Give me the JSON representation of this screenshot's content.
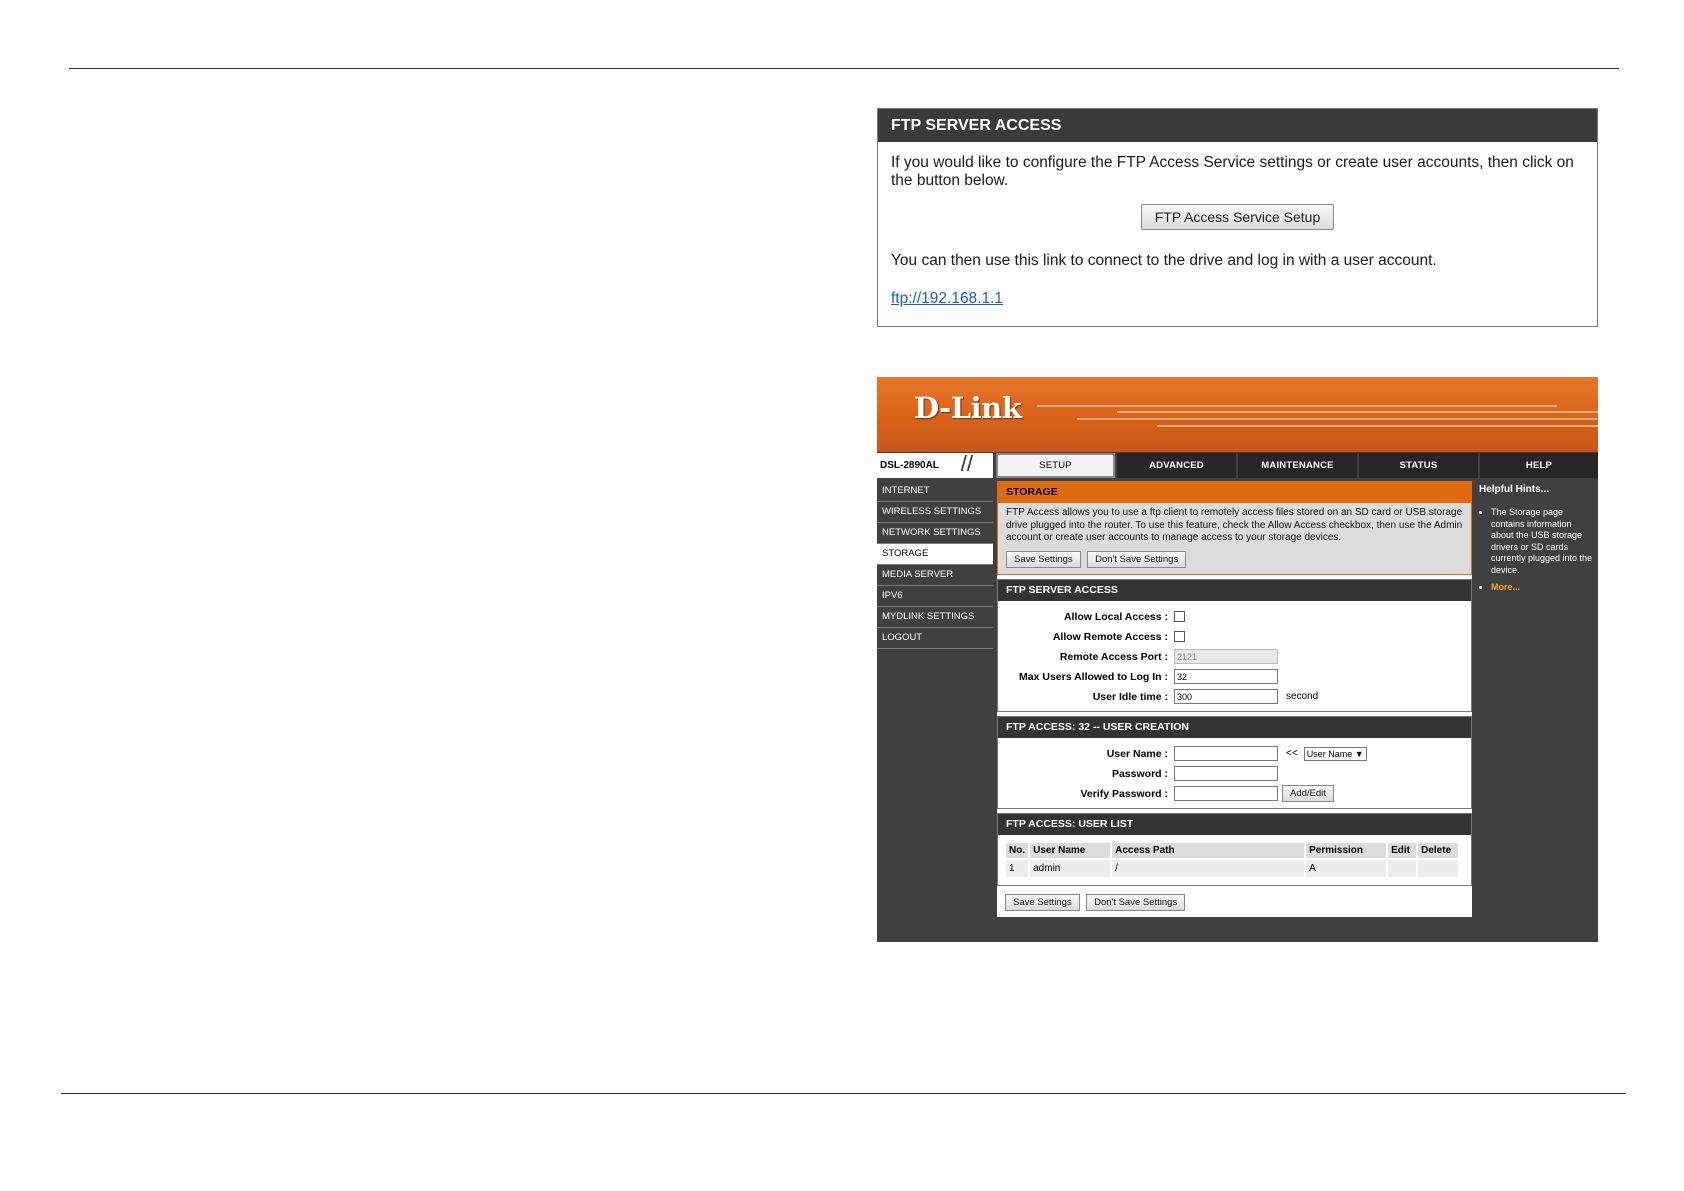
{
  "ftp_panel": {
    "title": "FTP SERVER ACCESS",
    "intro": "If you would like to configure the FTP Access Service settings or create user accounts, then click on the button below.",
    "button": "FTP Access Service Setup",
    "link_text": "You can then use this link to connect to the drive and log in with a user account.",
    "link": "ftp://192.168.1.1"
  },
  "router": {
    "logo": "D-Link",
    "model": "DSL-2890AL",
    "tabs": [
      "SETUP",
      "ADVANCED",
      "MAINTENANCE",
      "STATUS",
      "HELP"
    ],
    "active_tab": "SETUP",
    "sidebar": [
      "INTERNET",
      "WIRELESS SETTINGS",
      "NETWORK SETTINGS",
      "STORAGE",
      "MEDIA SERVER",
      "IPV6",
      "MYDLINK SETTINGS",
      "LOGOUT"
    ],
    "active_sidebar": "STORAGE",
    "storage": {
      "title": "STORAGE",
      "description": "FTP Access allows you to use a ftp client to remotely access files stored on an SD card or USB storage drive plugged into the router. To use this feature, check the Allow Access checkbox, then use the Admin account or create user accounts to manage access to your storage devices.",
      "save": "Save Settings",
      "dont_save": "Don't Save Settings"
    },
    "server_access": {
      "title": "FTP SERVER ACCESS",
      "allow_local_label": "Allow Local Access :",
      "allow_remote_label": "Allow Remote Access :",
      "remote_port_label": "Remote Access Port :",
      "remote_port_value": "2121",
      "max_users_label": "Max Users Allowed to Log In :",
      "max_users_value": "32",
      "idle_label": "User Idle time :",
      "idle_value": "300",
      "idle_unit": "second"
    },
    "user_creation": {
      "title": "FTP ACCESS: 32 -- USER CREATION",
      "username_label": "User Name :",
      "arrow": "<<",
      "select_value": "User Name",
      "password_label": "Password :",
      "verify_label": "Verify Password :",
      "add_edit": "Add/Edit"
    },
    "user_list": {
      "title": "FTP ACCESS: USER LIST",
      "columns": [
        "No.",
        "User Name",
        "Access Path",
        "Permission",
        "Edit",
        "Delete"
      ],
      "rows": [
        [
          "1",
          "admin",
          "/",
          "A",
          "",
          ""
        ]
      ]
    },
    "bottom_save": "Save Settings",
    "bottom_dont_save": "Don't Save Settings",
    "help": {
      "title": "Helpful Hints...",
      "hint": "The Storage page contains information about the USB storage drivers or SD cards currently plugged into the device.",
      "more": "More..."
    }
  }
}
